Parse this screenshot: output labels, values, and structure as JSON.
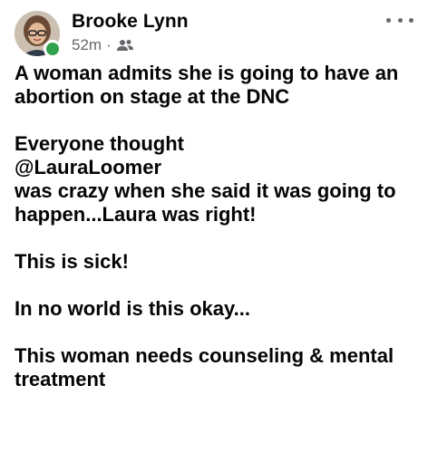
{
  "post": {
    "author": "Brooke Lynn",
    "time": "52m",
    "separator": "·",
    "audience_icon": "friends-icon",
    "more_icon": "more-options-icon",
    "paragraphs": [
      "A woman admits she is going to have an abortion on stage at the DNC",
      "Everyone thought\n@LauraLoomer\n was crazy when she said it was going to happen...Laura was right!",
      "This is sick!",
      " In no world is this okay...",
      "This woman needs counseling & mental treatment"
    ]
  },
  "colors": {
    "text": "#050505",
    "secondary": "#65676b",
    "online": "#31a24c"
  }
}
